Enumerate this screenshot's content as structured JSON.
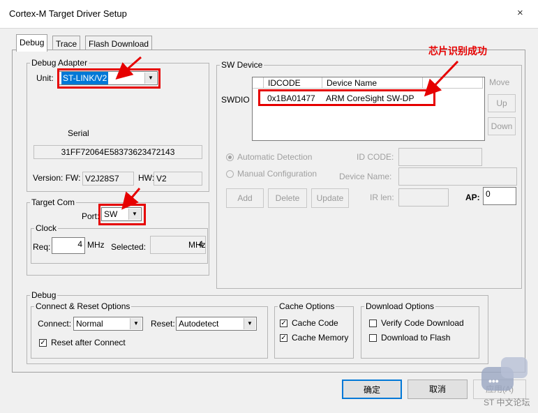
{
  "window": {
    "title": "Cortex-M Target Driver Setup",
    "close_glyph": "×"
  },
  "tabs": [
    {
      "label": "Debug",
      "active": true
    },
    {
      "label": "Trace",
      "active": false
    },
    {
      "label": "Flash Download",
      "active": false
    }
  ],
  "debug_adapter": {
    "legend": "Debug Adapter",
    "unit_label": "Unit:",
    "unit_value": "ST-LINK/V2",
    "serial_label": "Serial",
    "serial_value": "31FF72064E58373623472143",
    "version_label": "Version: FW:",
    "fw_value": "V2J28S7",
    "hw_label": "HW:",
    "hw_value": "V2"
  },
  "target_com": {
    "legend": "Target Com",
    "port_label": "Port:",
    "port_value": "SW",
    "clock_legend": "Clock",
    "req_label": "Req:",
    "req_value": "4",
    "req_unit": "MHz",
    "selected_label": "Selected:",
    "selected_value": "4",
    "selected_unit": "MHz"
  },
  "sw_device": {
    "legend": "SW Device",
    "swdio_label": "SWDIO",
    "columns": [
      "IDCODE",
      "Device Name"
    ],
    "rows": [
      {
        "idcode": "0x1BA01477",
        "device_name": "ARM CoreSight SW-DP"
      }
    ],
    "move_label": "Move",
    "up_label": "Up",
    "down_label": "Down",
    "auto_detect_label": "Automatic Detection",
    "manual_config_label": "Manual Configuration",
    "id_code_label": "ID CODE:",
    "device_name_label": "Device Name:",
    "ir_len_label": "IR len:",
    "ap_label": "AP:",
    "ap_value": "0",
    "add_label": "Add",
    "delete_label": "Delete",
    "update_label": "Update"
  },
  "debug": {
    "legend": "Debug",
    "connect_reset_legend": "Connect & Reset Options",
    "connect_label": "Connect:",
    "connect_value": "Normal",
    "reset_label": "Reset:",
    "reset_value": "Autodetect",
    "reset_after_connect_label": "Reset after Connect",
    "reset_after_connect_checked": true,
    "cache_legend": "Cache Options",
    "cache_code_label": "Cache Code",
    "cache_code_checked": true,
    "cache_memory_label": "Cache Memory",
    "cache_memory_checked": true,
    "download_legend": "Download Options",
    "verify_label": "Verify Code Download",
    "verify_checked": false,
    "download_flash_label": "Download to Flash",
    "download_flash_checked": false
  },
  "footer": {
    "ok_label": "确定",
    "cancel_label": "取消",
    "apply_label": "应用(A)"
  },
  "annotation": {
    "text": "芯片识别成功",
    "color": "#e60000"
  },
  "watermark": {
    "text": "ST 中文论坛"
  }
}
